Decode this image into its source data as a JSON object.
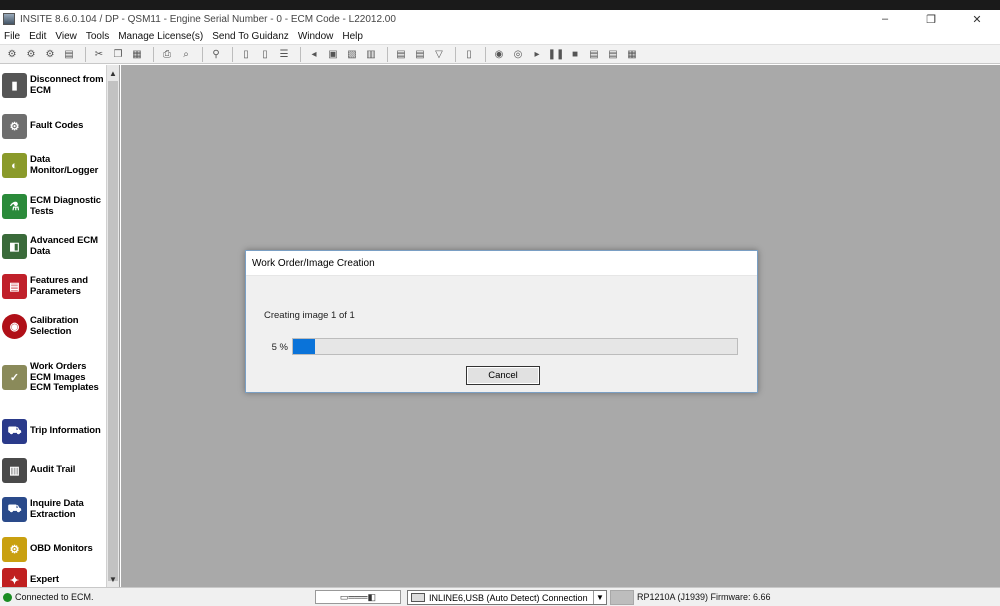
{
  "window": {
    "title": "INSITE 8.6.0.104  / DP - QSM11 - Engine Serial Number - 0 - ECM Code - L22012.00",
    "minimize": "–",
    "maximize": "❐",
    "close": "✕"
  },
  "menu": [
    "File",
    "Edit",
    "View",
    "Tools",
    "Manage License(s)",
    "Send To Guidanz",
    "Window",
    "Help"
  ],
  "sidebar": {
    "items": [
      {
        "label": "Disconnect from\nECM",
        "icon": "disconnect-icon",
        "color": "#555555"
      },
      {
        "label": "Fault Codes",
        "icon": "fault-codes-icon",
        "color": "#6e6e6e"
      },
      {
        "label": "Data\nMonitor/Logger",
        "icon": "data-monitor-icon",
        "color": "#8a9a2a"
      },
      {
        "label": "ECM Diagnostic\nTests",
        "icon": "diagnostic-tests-icon",
        "color": "#2a8a3a"
      },
      {
        "label": "Advanced ECM\nData",
        "icon": "advanced-ecm-icon",
        "color": "#3a6a3a"
      },
      {
        "label": "Features and\nParameters",
        "icon": "features-parameters-icon",
        "color": "#c0202a"
      },
      {
        "label": "Calibration\nSelection",
        "icon": "calibration-icon",
        "color": "#b01018"
      },
      {
        "label": "Work Orders\nECM Images\nECM Templates",
        "icon": "work-orders-icon",
        "color": "#8a8a5a"
      },
      {
        "label": "Trip Information",
        "icon": "trip-info-icon",
        "color": "#2a3a8a"
      },
      {
        "label": "Audit Trail",
        "icon": "audit-trail-icon",
        "color": "#4a4a4a"
      },
      {
        "label": "Inquire Data\nExtraction",
        "icon": "inquire-data-icon",
        "color": "#2a4a8a"
      },
      {
        "label": "OBD Monitors",
        "icon": "obd-monitors-icon",
        "color": "#c9a010"
      },
      {
        "label": "Expert",
        "icon": "expert-icon",
        "color": "#c02020"
      }
    ]
  },
  "dialog": {
    "title": "Work Order/Image Creation",
    "status": "Creating image 1 of 1",
    "progress_label": "5 %",
    "progress_fraction": 0.05,
    "cancel_label": "Cancel",
    "progress_color": "#0a73d9"
  },
  "statusbar": {
    "connection": "Connected to ECM.",
    "adapter": "INLINE6,USB (Auto Detect) Connection",
    "protocol": "RP1210A (J1939)  Firmware: 6.66"
  }
}
